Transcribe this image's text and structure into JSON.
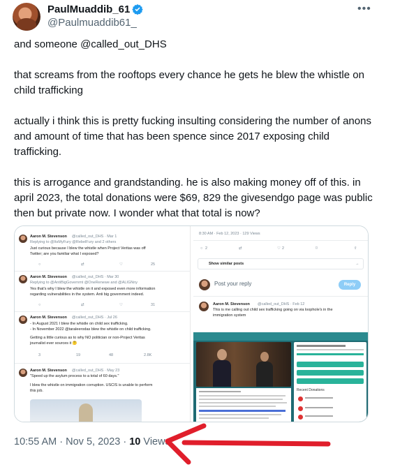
{
  "author": {
    "display_name": "PaulMuaddib_61",
    "handle": "@Paulmuaddib61_"
  },
  "more_label": "•••",
  "tweet_body": [
    "and someone @called_out_DHS",
    "that screams from the rooftops every chance he gets he blew the whistle on child trafficking",
    "actually i think this is pretty fucking insulting considering the number of anons and amount of time that has been spence since 2017 exposing child trafficking.",
    "this is arrogance and grandstanding. he is also making money off of this. in april 2023, the total donations were $69, 829 the givesendgo page was public then but private now. I wonder what that total is now?"
  ],
  "media": {
    "left": {
      "posts": [
        {
          "author": "Aaron M. Stevenson",
          "handle": "@called_out_DHS · Mar 1",
          "reply_to": "Replying to @ItsMyFury @RebelFury and 2 others",
          "text1": "Just curious because I blew the whistle when Project Veritas was off",
          "text2": "Twitter; are you familiar what I exposed?",
          "views": "25"
        },
        {
          "author": "Aaron M. Stevenson",
          "handle": "@called_out_DHS · Mar 30",
          "reply_to": "Replying to @AntiBigGovernmt @OneRenewe and @ALIGNny",
          "text1": "Yes that's why I blew the whistle on it and exposed even more information",
          "text2": "regarding vulnerabilities in the system. Anti big government indeed.",
          "views": "31"
        },
        {
          "author": "Aaron M. Stevenson",
          "handle": "@called_out_DHS · Jul 26",
          "reply_to": "",
          "text1": "- In August 2021 I blew the whistle on child sex trafficking.",
          "text2": "- In November 2022 @taraleerodas blew the whistle on child trafficking.",
          "text3": "Getting a little curious as to why NO politician or non-Project Veritas",
          "text4": "journalist ever sources it 🤔",
          "counts": [
            "3",
            "19",
            "48",
            "2.8K"
          ]
        },
        {
          "author": "Aaron M. Stevenson",
          "handle": "@called_out_DHS · May 23",
          "reply_to": "",
          "text1": "\"Speed up the asylum process to a total of 60 days.\"",
          "text2": "I blew the whistle on immigration corruption. USCIS is unable to perform",
          "text3": "this job."
        }
      ]
    },
    "right": {
      "meta": "8:30 AM · Feb 12, 2023 · 129 Views",
      "counts": [
        "2",
        "2"
      ],
      "show_similar": "Show similar posts",
      "reply_placeholder": "Post your reply",
      "reply_button": "Reply",
      "post_author": "Aaron M. Stevenson",
      "post_handle": "@called_out_DHS · Feb 12",
      "post_text1": "This is me calling out child sex trafficking going on via loophole's in the",
      "post_text2": "immigration system",
      "donations_label": "Recent Donations"
    }
  },
  "timestamp": {
    "time_date": "10:55 AM · Nov 5, 2023 · ",
    "views_count": "10",
    "views_label": " Views"
  },
  "colors": {
    "text": "#0f1419",
    "muted": "#536471",
    "link": "#1d9bf0",
    "verified": "#1d9bf0",
    "arrow": "#e01e2b"
  }
}
